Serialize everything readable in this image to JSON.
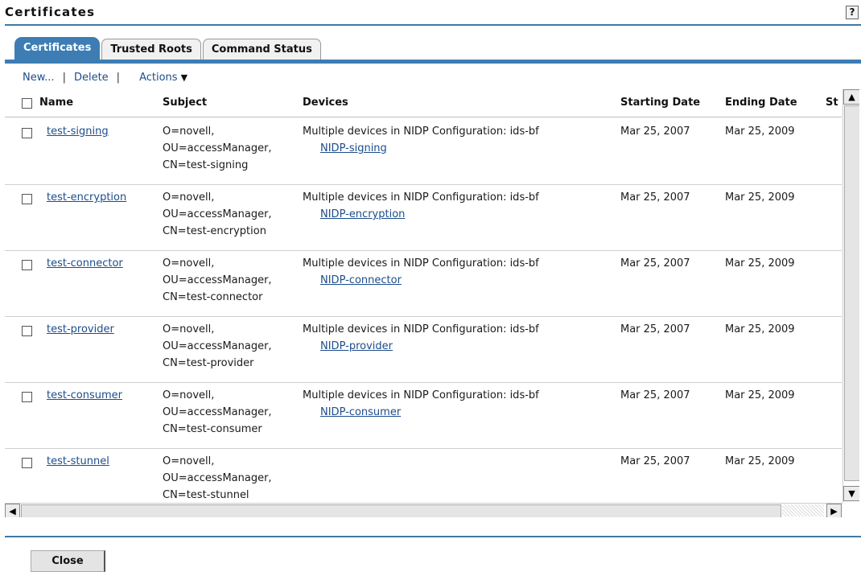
{
  "page": {
    "title": "Certificates",
    "help_label": "?"
  },
  "tabs": [
    {
      "label": "Certificates",
      "active": true
    },
    {
      "label": "Trusted Roots",
      "active": false
    },
    {
      "label": "Command Status",
      "active": false
    }
  ],
  "toolbar": {
    "new_label": "New...",
    "delete_label": "Delete",
    "actions_label": "Actions",
    "sep": "|"
  },
  "columns": {
    "name": "Name",
    "subject": "Subject",
    "devices": "Devices",
    "start": "Starting Date",
    "end": "Ending Date",
    "status": "St"
  },
  "rows": [
    {
      "name": "test-signing",
      "subject": [
        "O=novell,",
        "OU=accessManager,",
        "CN=test-signing"
      ],
      "devices": "Multiple devices in NIDP Configuration: ids-bf",
      "device_link": "NIDP-signing",
      "start": "Mar 25, 2007",
      "end": "Mar 25, 2009"
    },
    {
      "name": "test-encryption",
      "subject": [
        "O=novell,",
        "OU=accessManager,",
        "CN=test-encryption"
      ],
      "devices": "Multiple devices in NIDP Configuration: ids-bf",
      "device_link": "NIDP-encryption",
      "start": "Mar 25, 2007",
      "end": "Mar 25, 2009"
    },
    {
      "name": "test-connector",
      "subject": [
        "O=novell,",
        "OU=accessManager,",
        "CN=test-connector"
      ],
      "devices": "Multiple devices in NIDP Configuration: ids-bf",
      "device_link": "NIDP-connector",
      "start": "Mar 25, 2007",
      "end": "Mar 25, 2009"
    },
    {
      "name": "test-provider",
      "subject": [
        "O=novell,",
        "OU=accessManager,",
        "CN=test-provider"
      ],
      "devices": "Multiple devices in NIDP Configuration: ids-bf",
      "device_link": "NIDP-provider",
      "start": "Mar 25, 2007",
      "end": "Mar 25, 2009"
    },
    {
      "name": "test-consumer",
      "subject": [
        "O=novell,",
        "OU=accessManager,",
        "CN=test-consumer"
      ],
      "devices": "Multiple devices in NIDP Configuration: ids-bf",
      "device_link": "NIDP-consumer",
      "start": "Mar 25, 2007",
      "end": "Mar 25, 2009"
    },
    {
      "name": "test-stunnel",
      "subject": [
        "O=novell,",
        "OU=accessManager,",
        "CN=test-stunnel"
      ],
      "devices": "",
      "device_link": "",
      "start": "Mar 25, 2007",
      "end": "Mar 25, 2009"
    }
  ],
  "footer": {
    "close_label": "Close"
  }
}
